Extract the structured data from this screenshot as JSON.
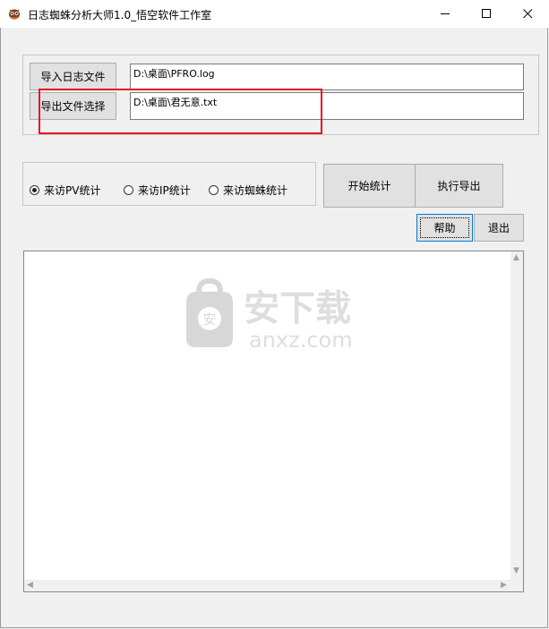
{
  "window": {
    "title": "日志蜘蛛分析大师1.0_悟空软件工作室"
  },
  "files": {
    "import_button": "导入日志文件",
    "import_path": "D:\\桌面\\PFRO.log",
    "export_button": "导出文件选择",
    "export_path": "D:\\桌面\\君无意.txt"
  },
  "stats": {
    "options": [
      "来访PV统计",
      "来访IP统计",
      "来访蜘蛛统计"
    ],
    "selected": "来访PV统计"
  },
  "actions": {
    "start": "开始统计",
    "export": "执行导出",
    "help": "帮助",
    "exit": "退出"
  },
  "watermark": {
    "text_cn": "安下载",
    "text_en": "anxz.com"
  }
}
